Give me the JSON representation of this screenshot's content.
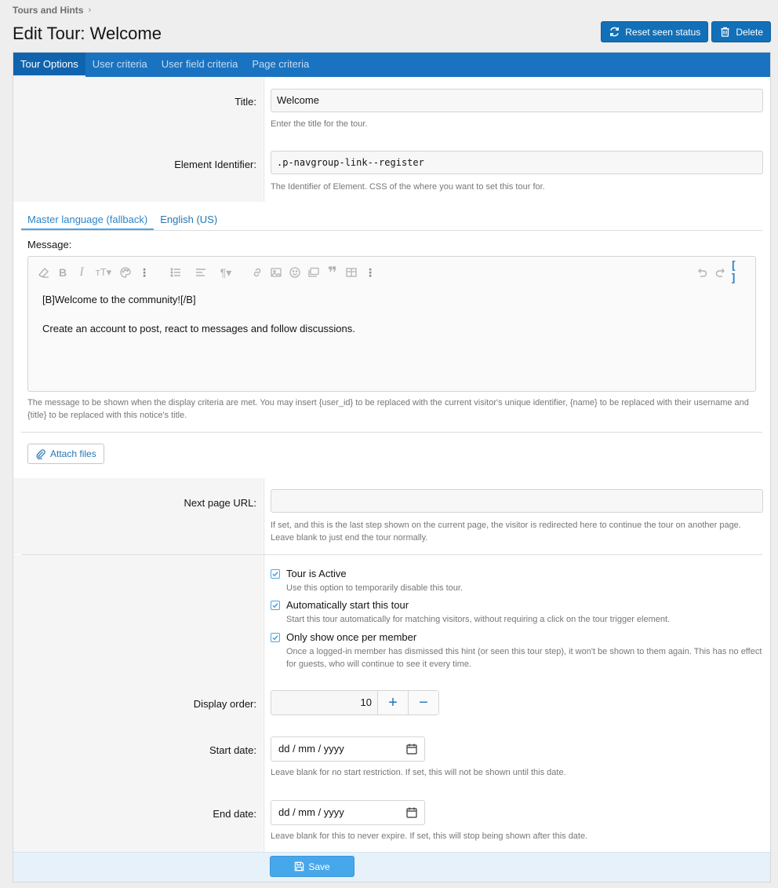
{
  "breadcrumb": {
    "item": "Tours and Hints"
  },
  "page": {
    "title": "Edit Tour: Welcome"
  },
  "actions": {
    "reset_label": "Reset seen status",
    "delete_label": "Delete"
  },
  "tabs": [
    {
      "label": "Tour Options",
      "active": true
    },
    {
      "label": "User criteria",
      "active": false
    },
    {
      "label": "User field criteria",
      "active": false
    },
    {
      "label": "Page criteria",
      "active": false
    }
  ],
  "form": {
    "title": {
      "label": "Title:",
      "value": "Welcome",
      "hint": "Enter the title for the tour."
    },
    "element_identifier": {
      "label": "Element Identifier:",
      "value": ".p-navgroup-link--register",
      "hint": "The Identifier of Element. CSS of the where you want to set this tour for."
    },
    "language_tabs": [
      "Master language (fallback)",
      "English (US)"
    ],
    "message": {
      "label": "Message:",
      "lines": [
        "[B]Welcome to the community![/B]",
        "Create an account to post, react to messages and follow discussions."
      ],
      "hint": "The message to be shown when the display criteria are met. You may insert {user_id} to be replaced with the current visitor's unique identifier, {name} to be replaced with their username and {title} to be replaced with this notice's title."
    },
    "attach_label": "Attach files",
    "next_page_url": {
      "label": "Next page URL:",
      "value": "",
      "hint": "If set, and this is the last step shown on the current page, the visitor is redirected here to continue the tour on another page. Leave blank to just end the tour normally."
    },
    "options": [
      {
        "label": "Tour is Active",
        "checked": true,
        "hint": "Use this option to temporarily disable this tour."
      },
      {
        "label": "Automatically start this tour",
        "checked": true,
        "hint": "Start this tour automatically for matching visitors, without requiring a click on the tour trigger element."
      },
      {
        "label": "Only show once per member",
        "checked": true,
        "hint": "Once a logged-in member has dismissed this hint (or seen this tour step), it won't be shown to them again. This has no effect for guests, who will continue to see it every time."
      }
    ],
    "display_order": {
      "label": "Display order:",
      "value": "10",
      "plus": "+",
      "minus": "−"
    },
    "start_date": {
      "label": "Start date:",
      "placeholder": "dd / mm / yyyy",
      "hint": "Leave blank for no start restriction. If set, this will not be shown until this date."
    },
    "end_date": {
      "label": "End date:",
      "placeholder": "dd / mm / yyyy",
      "hint": "Leave blank for this to never expire. If set, this will stop being shown after this date."
    }
  },
  "footer": {
    "save_label": "Save"
  },
  "colors": {
    "accent": "#1a73c0",
    "primary_button": "#47a7eb",
    "link": "#2577b1"
  }
}
